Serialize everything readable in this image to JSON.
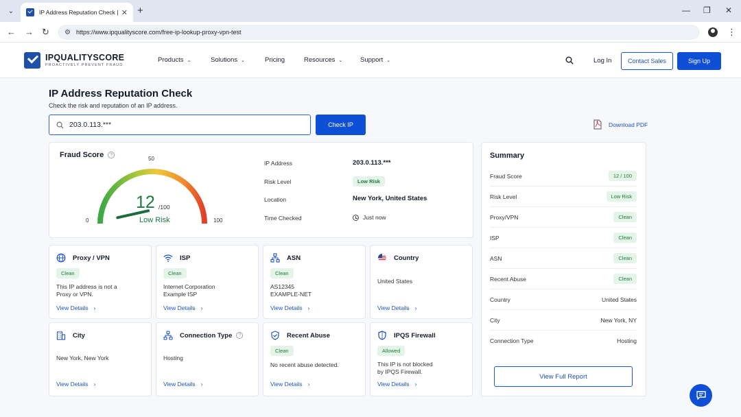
{
  "browser": {
    "tab_title": "IP Address Reputation Check | IPQ",
    "url": "https://www.ipqualityscore.com/free-ip-lookup-proxy-vpn-test"
  },
  "header": {
    "logo_name": "IPQUALITYSCORE",
    "logo_tagline": "PROACTIVELY PREVENT FRAUD",
    "nav": [
      "Products",
      "Solutions",
      "Pricing",
      "Resources",
      "Support"
    ],
    "login": "Log In",
    "contact": "Contact Sales",
    "signup": "Sign Up"
  },
  "page": {
    "title": "IP Address Reputation Check",
    "subtitle": "Check the risk and reputation of an IP address.",
    "ip_value": "203.0.113.***",
    "check_button": "Check IP",
    "download_pdf": "Download PDF"
  },
  "fraud_score": {
    "title": "Fraud Score",
    "score": "12",
    "score_max": "/100",
    "score_value": 12,
    "risk_label": "Low Risk",
    "scale_min": "0",
    "scale_mid": "50",
    "scale_max": "100",
    "info": {
      "ip_label": "IP Address",
      "ip_value": "203.0.113.***",
      "risk_label": "Risk Level",
      "risk_value": "Low Risk",
      "location_label": "Location",
      "location_value": "New York, United States",
      "time_label": "Time Checked",
      "time_value": "Just now"
    }
  },
  "cards": [
    {
      "title": "Proxy / VPN",
      "icon": "globe-icon",
      "pill": "Clean",
      "text1": "This IP address is not a",
      "text2": "Proxy or VPN.",
      "link": "View Details"
    },
    {
      "title": "ISP",
      "icon": "wifi-icon",
      "pill": "Clean",
      "text1": "Internet Corporation",
      "text2": "Example ISP",
      "link": "View Details"
    },
    {
      "title": "ASN",
      "icon": "network-icon",
      "pill": "Clean",
      "text1": "AS12345",
      "text2": "EXAMPLE-NET",
      "link": "View Details"
    },
    {
      "title": "Country",
      "icon": "us-flag-icon",
      "text1": "United States",
      "link": "View Details"
    },
    {
      "title": "City",
      "icon": "building-icon",
      "text1": "New York, New York",
      "link": "View Details"
    },
    {
      "title": "Connection Type",
      "icon": "connection-icon",
      "text1": "Hosting",
      "link": "View Details"
    },
    {
      "title": "Recent Abuse",
      "icon": "shield-check-icon",
      "pill": "Clean",
      "text1": "No recent abuse detected.",
      "link": "View Details"
    },
    {
      "title": "IPQS Firewall",
      "icon": "shield-icon",
      "pill": "Allowed",
      "text1": "This IP is not blocked",
      "text2": "by IPQS Firewall.",
      "link": "View Details"
    }
  ],
  "summary": {
    "title": "Summary",
    "rows": [
      {
        "label": "Fraud Score",
        "value": "12 / 100",
        "pill": true
      },
      {
        "label": "Risk Level",
        "value": "Low Risk",
        "pill": true
      },
      {
        "label": "Proxy/VPN",
        "value": "Clean",
        "pill": true
      },
      {
        "label": "ISP",
        "value": "Clean",
        "pill": true
      },
      {
        "label": "ASN",
        "value": "Clean",
        "pill": true
      },
      {
        "label": "Recent Abuse",
        "value": "Clean",
        "pill": true
      },
      {
        "label": "Country",
        "value": "United States",
        "pill": false
      },
      {
        "label": "City",
        "value": "New York, NY",
        "pill": false
      },
      {
        "label": "Connection Type",
        "value": "Hosting",
        "pill": false
      }
    ],
    "button": "View Full Report"
  },
  "colors": {
    "accent": "#0f4fd6",
    "success": "#1c7a3e",
    "pill_bg": "#e4f4e8"
  }
}
